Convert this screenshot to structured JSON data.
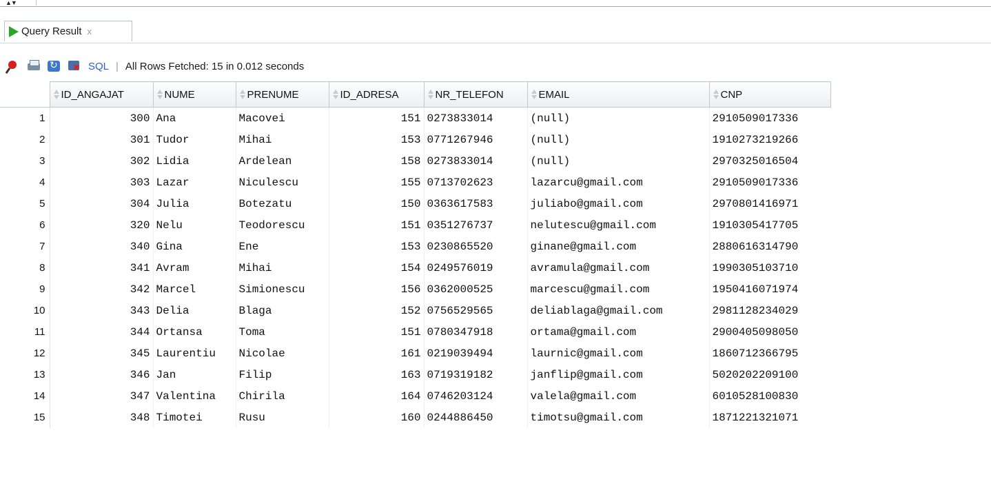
{
  "tab": {
    "label": "Query Result",
    "close_label": "x"
  },
  "toolbar": {
    "sql_label": "SQL",
    "separator": "|",
    "status": "All Rows Fetched: 15 in 0.012 seconds",
    "icons": [
      "pin-icon",
      "print-icon",
      "refresh-icon",
      "rollback-icon"
    ]
  },
  "grid": {
    "columns": [
      "ID_ANGAJAT",
      "NUME",
      "PRENUME",
      "ID_ADRESA",
      "NR_TELEFON",
      "EMAIL",
      "CNP"
    ],
    "rows": [
      [
        "1",
        "300",
        "Ana",
        "Macovei",
        "151",
        "0273833014",
        "(null)",
        "2910509017336"
      ],
      [
        "2",
        "301",
        "Tudor",
        "Mihai",
        "153",
        "0771267946",
        "(null)",
        "1910273219266"
      ],
      [
        "3",
        "302",
        "Lidia",
        "Ardelean",
        "158",
        "0273833014",
        "(null)",
        "2970325016504"
      ],
      [
        "4",
        "303",
        "Lazar",
        "Niculescu",
        "155",
        "0713702623",
        "lazarcu@gmail.com",
        "2910509017336"
      ],
      [
        "5",
        "304",
        "Julia",
        "Botezatu",
        "150",
        "0363617583",
        "juliabo@gmail.com",
        "2970801416971"
      ],
      [
        "6",
        "320",
        "Nelu",
        "Teodorescu",
        "151",
        "0351276737",
        "nelutescu@gmail.com",
        "1910305417705"
      ],
      [
        "7",
        "340",
        "Gina",
        "Ene",
        "153",
        "0230865520",
        "ginane@gmail.com",
        "2880616314790"
      ],
      [
        "8",
        "341",
        "Avram",
        "Mihai",
        "154",
        "0249576019",
        "avramula@gmail.com",
        "1990305103710"
      ],
      [
        "9",
        "342",
        "Marcel",
        "Simionescu",
        "156",
        "0362000525",
        "marcescu@gmail.com",
        "1950416071974"
      ],
      [
        "10",
        "343",
        "Delia",
        "Blaga",
        "152",
        "0756529565",
        "deliablaga@gmail.com",
        "2981128234029"
      ],
      [
        "11",
        "344",
        "Ortansa",
        "Toma",
        "151",
        "0780347918",
        "ortama@gmail.com",
        "2900405098050"
      ],
      [
        "12",
        "345",
        "Laurentiu",
        "Nicolae",
        "161",
        "0219039494",
        "laurnic@gmail.com",
        "1860712366795"
      ],
      [
        "13",
        "346",
        "Jan",
        "Filip",
        "163",
        "0719319182",
        "janflip@gmail.com",
        "5020202209100"
      ],
      [
        "14",
        "347",
        "Valentina",
        "Chirila",
        "164",
        "0746203124",
        "valela@gmail.com",
        "6010528100830"
      ],
      [
        "15",
        "348",
        "Timotei",
        "Rusu",
        "160",
        "0244886450",
        "timotsu@gmail.com",
        "1871221321071"
      ]
    ]
  }
}
